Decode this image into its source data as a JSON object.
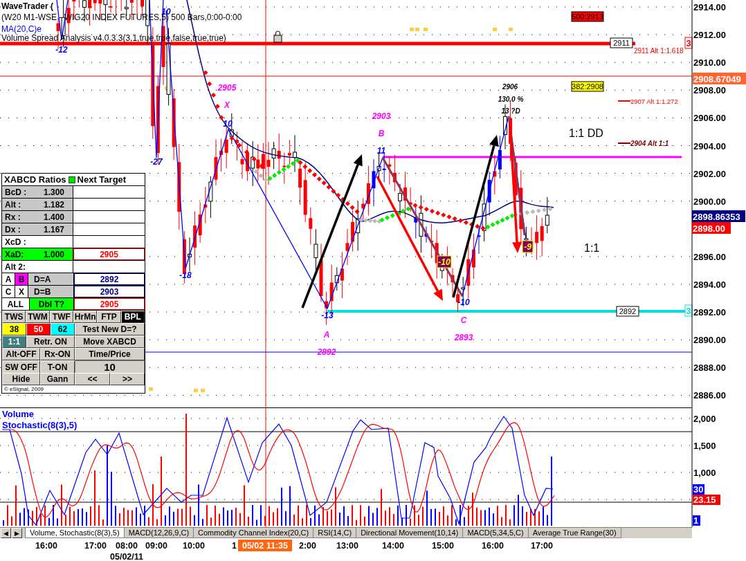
{
  "header": {
    "title": "WaveTrader (",
    "symbol": "(W20 M1-WSE - WIG20 INDEX FUTURES,5) 500 Bars,0:00-0:00",
    "study": "MA(20,C)e",
    "indicator": "Volume Spread Analysis v4.0.3.3(3,1,true,true,false,true,true)"
  },
  "price_axis": {
    "ticks": [
      "2914.00",
      "2912.00",
      "2910.00",
      "2908.00",
      "2906.00",
      "2904.00",
      "2902.00",
      "2900.00",
      "2896.00",
      "2894.00",
      "2892.00",
      "2890.00",
      "2888.00",
      "2886.00"
    ],
    "badges": [
      {
        "text": "2908.67049",
        "color": "#ff6633"
      },
      {
        "text": "2898.86353",
        "color": "#000080"
      },
      {
        "text": "2898.00",
        "color": "#ff0000"
      }
    ]
  },
  "annotations": [
    {
      "kind": "label",
      "text": "10",
      "color": "#0000ff"
    },
    {
      "kind": "box",
      "text": "500:2913",
      "color": "#ff0000"
    },
    {
      "kind": "tag",
      "text": "2911"
    },
    {
      "kind": "plain",
      "text": "2911 Alt 1:1.618",
      "color": "#ff0000"
    },
    {
      "kind": "edge",
      "text": "3",
      "color": "#ff0000"
    },
    {
      "kind": "label",
      "text": "-12",
      "color": "#0000ff"
    },
    {
      "kind": "label",
      "text": "2905",
      "color": "#ff00ff"
    },
    {
      "kind": "note",
      "text": "2906",
      "color": "#000000"
    },
    {
      "kind": "box",
      "text": "382:2908",
      "color": "#ffff00"
    },
    {
      "kind": "note",
      "text": "130.0 %",
      "color": "#000000"
    },
    {
      "kind": "level",
      "text": "2907 Alt 1:1.272",
      "color": "#ff0000"
    },
    {
      "kind": "label",
      "text": "X",
      "color": "#ff00ff"
    },
    {
      "kind": "note",
      "text": "13 ?D",
      "color": "#000000"
    },
    {
      "kind": "label",
      "text": "2903",
      "color": "#ff00ff"
    },
    {
      "kind": "label",
      "text": "10",
      "color": "#0000ff"
    },
    {
      "kind": "big",
      "text": "1:1 DD",
      "color": "#000000"
    },
    {
      "kind": "label",
      "text": "B",
      "color": "#ff00ff"
    },
    {
      "kind": "key-level",
      "text": "2904 Alt 1:1",
      "color": "#800000"
    },
    {
      "kind": "label",
      "text": "11",
      "color": "#0000ff"
    },
    {
      "kind": "label",
      "text": "-27",
      "color": "#0000ff"
    },
    {
      "kind": "score",
      "text": "-9",
      "color": "#800060"
    },
    {
      "kind": "big",
      "text": "1:1",
      "color": "#000000"
    },
    {
      "kind": "score",
      "text": "-10",
      "color": "#800060"
    },
    {
      "kind": "label",
      "text": "-18",
      "color": "#0000ff"
    },
    {
      "kind": "label",
      "text": "-10",
      "color": "#0000ff"
    },
    {
      "kind": "tag",
      "text": "2892"
    },
    {
      "kind": "edge",
      "text": "3",
      "color": "#00dddd"
    },
    {
      "kind": "label",
      "text": "-13",
      "color": "#0000ff"
    },
    {
      "kind": "label",
      "text": "C",
      "color": "#ff00ff"
    },
    {
      "kind": "label",
      "text": "A",
      "color": "#ff00ff"
    },
    {
      "kind": "label",
      "text": "2893",
      "color": "#ff00ff"
    },
    {
      "kind": "label",
      "text": "2892",
      "color": "#ff00ff"
    }
  ],
  "xabcd_panel": {
    "title": "XABCD Ratios",
    "legend": "Next Target",
    "rows": [
      {
        "kind": "ratio",
        "label": "BcD :",
        "value": "1.300"
      },
      {
        "kind": "ratio",
        "label": "Alt :",
        "value": "1.182"
      },
      {
        "kind": "ratio",
        "label": "Rx :",
        "value": "1.400"
      },
      {
        "kind": "ratio",
        "label": "Dx :",
        "value": "1.167"
      },
      {
        "kind": "heading",
        "label": "XcD :"
      },
      {
        "kind": "active",
        "label": "XaD:",
        "value": "1.000",
        "target": "2905"
      },
      {
        "kind": "heading",
        "label": "Alt 2:"
      }
    ],
    "targets": [
      {
        "points": [
          {
            "label": "A",
            "selected": false
          },
          {
            "label": "B",
            "selected": true
          }
        ],
        "rule": "D=A",
        "on": false,
        "value": "2892",
        "color": "#000080"
      },
      {
        "points": [
          {
            "label": "C",
            "selected": false
          },
          {
            "label": "X",
            "selected": false
          }
        ],
        "rule": "D=B",
        "on": false,
        "value": "2903",
        "color": "#000080"
      },
      {
        "points": [
          {
            "label": "ALL",
            "selected": false
          }
        ],
        "rule": "Dbl T?",
        "on": true,
        "value": "2905",
        "color": "#ff0000"
      }
    ],
    "controls": [
      [
        {
          "kind": "button",
          "label": "TWS",
          "selected": false
        },
        {
          "kind": "button",
          "label": "TWM",
          "selected": false
        },
        {
          "kind": "button",
          "label": "TWF",
          "selected": false
        },
        {
          "kind": "button",
          "label": "HrMn",
          "selected": false
        },
        {
          "kind": "button",
          "label": "FTP",
          "selected": false
        },
        {
          "kind": "button",
          "label": "BPL",
          "selected": true
        }
      ],
      [
        {
          "kind": "swatch",
          "label": "38",
          "color": "#ffff00"
        },
        {
          "kind": "swatch",
          "label": "50",
          "color": "#ff0000"
        },
        {
          "kind": "swatch",
          "label": "62",
          "color": "#00ffff"
        },
        {
          "kind": "button",
          "label": "Test New D=?"
        }
      ],
      [
        {
          "kind": "swatch",
          "label": "1:1",
          "color": "#408080"
        },
        {
          "kind": "button",
          "label": "Retr. ON"
        },
        {
          "kind": "button",
          "label": "Move XABCD"
        }
      ],
      [
        {
          "kind": "button",
          "label": "Alt-OFF"
        },
        {
          "kind": "button",
          "label": "Rx-ON"
        },
        {
          "kind": "button",
          "label": "Time/Price"
        }
      ],
      [
        {
          "kind": "button",
          "label": "SW OFF"
        },
        {
          "kind": "button",
          "label": "T-ON"
        },
        {
          "kind": "field",
          "value": "10"
        }
      ],
      [
        {
          "kind": "button",
          "label": "Hide"
        },
        {
          "kind": "button",
          "label": "Gann"
        },
        {
          "kind": "button",
          "label": "<<"
        },
        {
          "kind": "button",
          "label": ">>"
        }
      ]
    ],
    "copyright": "© eSignal, 2009"
  },
  "lower_pane": {
    "labels": [
      "Volume",
      "Stochastic(8(3),5)"
    ],
    "axis": [
      "2,000",
      "1,500",
      "1,000"
    ],
    "badges": [
      {
        "text": "30",
        "color": "#0000ff"
      },
      {
        "text": "23.15",
        "color": "#ff0000"
      },
      {
        "text": "1",
        "color": "#0000ff"
      }
    ]
  },
  "scroll_buttons": [
    "◀",
    "▶"
  ],
  "tabs": [
    {
      "label": "Volume, Stochastic(8(3),5)",
      "selected": true
    },
    {
      "label": "MACD(12,26,9,C)",
      "selected": false
    },
    {
      "label": "Commodity Channel Index(20,C)",
      "selected": false
    },
    {
      "label": "RSI(14,C)",
      "selected": false
    },
    {
      "label": "Directional Movement(10,14)",
      "selected": false
    },
    {
      "label": "MACD(5,34,5,C)",
      "selected": false
    },
    {
      "label": "Average True Range(30)",
      "selected": false
    }
  ],
  "time_axis": {
    "labels": [
      "16:00",
      "17:00",
      "08:00",
      "09:00",
      "10:00",
      "1",
      "2:00",
      "13:00",
      "14:00",
      "15:00",
      "16:00",
      "17:00"
    ],
    "date": "05/02/11",
    "cursor": "05/02 11:35"
  }
}
